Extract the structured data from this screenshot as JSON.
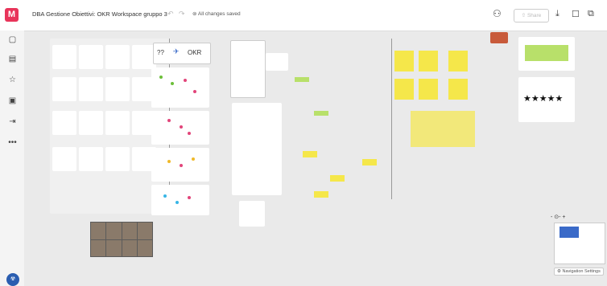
{
  "app": {
    "logo_letter": "M",
    "title": "DBA Gestione Obiettivi: OKR Workspace gruppo 3",
    "status": "All changes saved",
    "share_label": "Share"
  },
  "icons": {
    "undo": "undo-icon",
    "redo": "redo-icon",
    "user": "add-user-icon",
    "download": "download-icon",
    "comment": "comment-icon",
    "present": "present-icon"
  },
  "left_toolbar": [
    "page-icon",
    "templates-icon",
    "star-icon",
    "image-icon",
    "embed-icon",
    "more-icon"
  ],
  "board": {
    "okr_label": "OKR",
    "okr_number": "??",
    "zoom_label": "- ⊙- +"
  },
  "navigator": {
    "label": "Navigation Settings"
  },
  "colors": {
    "accent": "#e8345a",
    "sticky_yellow": "#f5e74a",
    "sticky_green": "#b8e06a",
    "dot_pink": "#e2457a",
    "dot_blue": "#38b6e6",
    "avatar_blue": "#2a5db0"
  }
}
